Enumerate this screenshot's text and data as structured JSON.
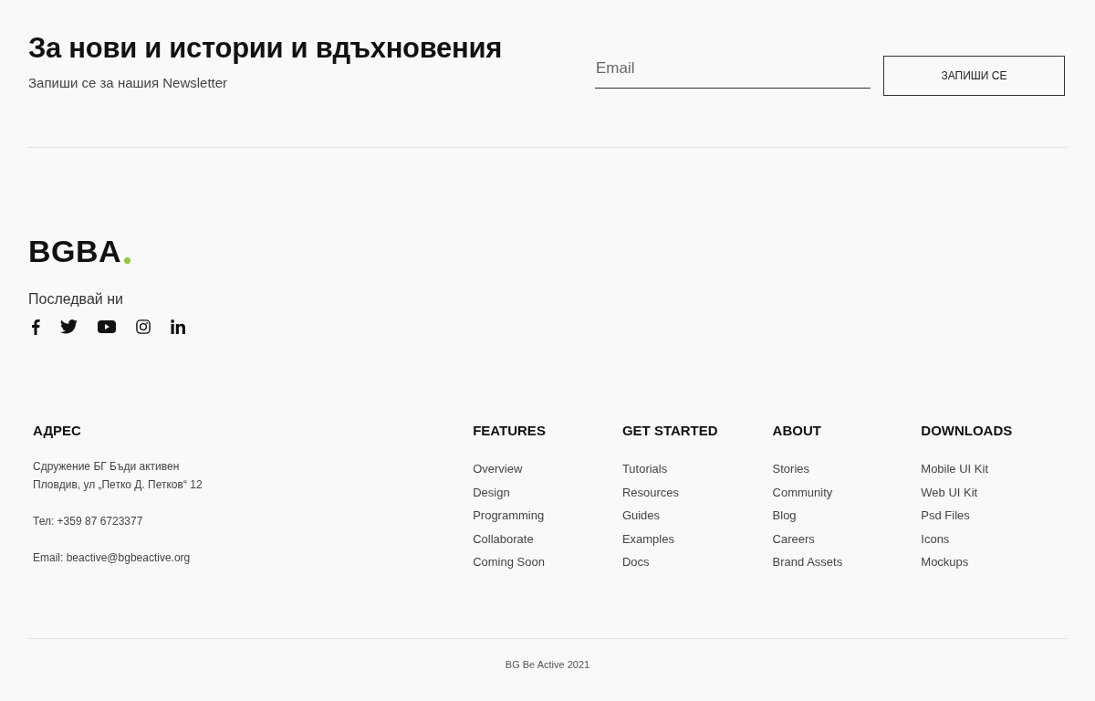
{
  "newsletter": {
    "title": "За нови и истории и вдъхновения",
    "subtitle": "Запиши се за нашия Newsletter",
    "email": {
      "placeholder": "Email"
    },
    "button": "ЗАПИШИ СЕ"
  },
  "brand": {
    "logo": "BGBA",
    "follow": "Последвай ни",
    "social": [
      {
        "kind": "facebook"
      },
      {
        "kind": "twitter"
      },
      {
        "kind": "youtube"
      },
      {
        "kind": "instagram"
      },
      {
        "kind": "linkedin"
      }
    ]
  },
  "address": {
    "heading": "АДРЕС",
    "groups": [
      [
        "Сдружение БГ Бъди активен",
        "Пловдив, ул „Петко Д. Петков“ 12"
      ],
      [
        "Тел:  +359 87 6723377"
      ],
      [
        "Email: beactive@bgbeactive.org"
      ]
    ]
  },
  "columns": [
    {
      "heading": "FEATURES",
      "links": [
        "Overview",
        "Design",
        "Programming",
        "Collaborate",
        "Coming Soon"
      ]
    },
    {
      "heading": "GET STARTED",
      "links": [
        "Tutorials",
        "Resources",
        "Guides",
        "Examples",
        "Docs"
      ]
    },
    {
      "heading": "ABOUT",
      "links": [
        "Stories",
        "Community",
        "Blog",
        "Careers",
        "Brand Assets"
      ]
    },
    {
      "heading": "DOWNLOADS",
      "links": [
        "Mobile UI Kit",
        "Web UI Kit",
        "Psd Files",
        "Icons",
        "Mockups"
      ]
    }
  ],
  "copyright": "BG Be Active 2021"
}
